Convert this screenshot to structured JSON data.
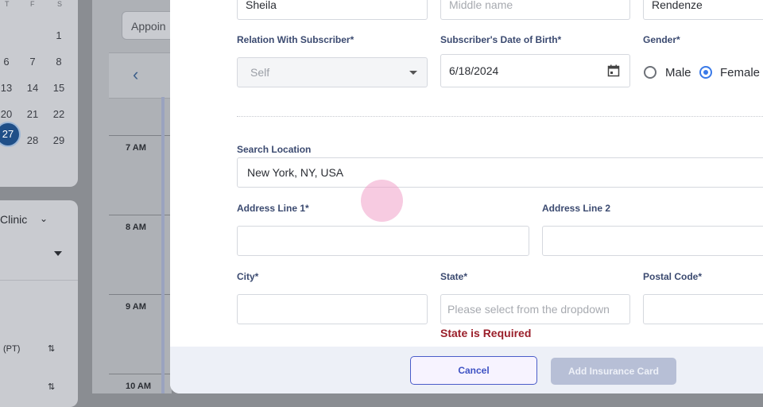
{
  "background": {
    "calendar": {
      "weekday_headers": [
        "T",
        "F",
        "S"
      ],
      "days": [
        "1",
        "6",
        "7",
        "8",
        "13",
        "14",
        "15",
        "20",
        "21",
        "22",
        "27",
        "28",
        "29"
      ],
      "selected_day": "27"
    },
    "filter_label": "Clinic",
    "timezone_label": "(PT)",
    "appointment_button": "Appoin",
    "times": [
      "7 AM",
      "8 AM",
      "9 AM",
      "10 AM"
    ]
  },
  "form": {
    "first_name_value": "Sheila",
    "middle_name_placeholder": "Middle name",
    "last_name_value": "Rendenze",
    "relation_label": "Relation With Subscriber*",
    "relation_value": "Self",
    "dob_label": "Subscriber's Date of Birth*",
    "dob_value": "6/18/2024",
    "gender_label": "Gender*",
    "gender_options": [
      "Male",
      "Female"
    ],
    "gender_selected": "Female",
    "search_location_label": "Search Location",
    "search_location_value": "New York, NY, USA",
    "address1_label": "Address Line 1*",
    "address2_label": "Address Line 2",
    "city_label": "City*",
    "state_label": "State*",
    "state_placeholder": "Please select from the dropdown",
    "state_error": "State is Required",
    "postal_label": "Postal Code*"
  },
  "footer": {
    "cancel_label": "Cancel",
    "add_label": "Add Insurance Card"
  },
  "colors": {
    "accent": "#3a7ae8",
    "error": "#9a1f2a",
    "button_primary_disabled": "#b7bfd6"
  }
}
